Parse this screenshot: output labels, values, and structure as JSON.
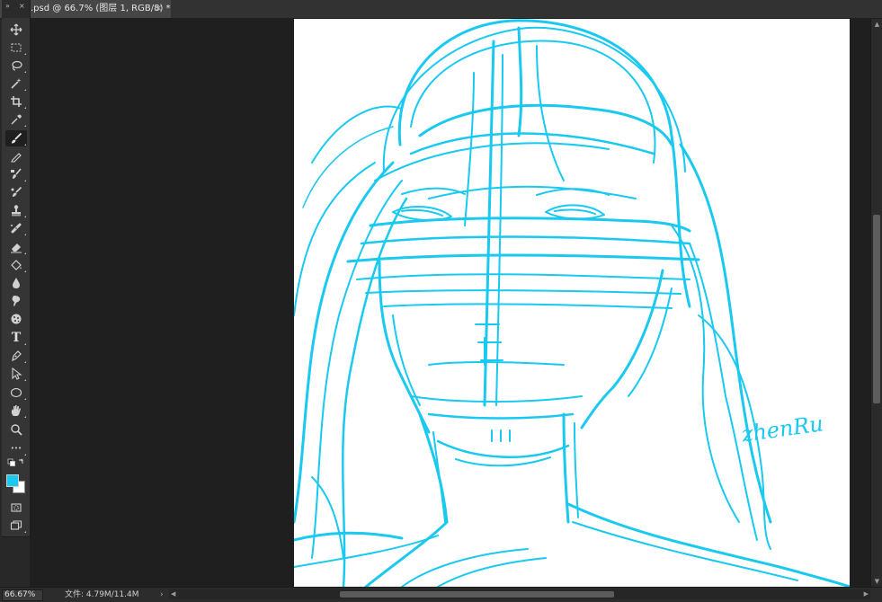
{
  "document_tab": {
    "title": ".psd @ 66.7% (图层 1, RGB/8) *",
    "close_glyph": "×"
  },
  "toolbar": {
    "collapse_glyph": "»",
    "close_glyph": "×",
    "tools": [
      {
        "name": "move-tool-icon"
      },
      {
        "name": "marquee-tool-icon"
      },
      {
        "name": "lasso-tool-icon"
      },
      {
        "name": "magic-wand-tool-icon"
      },
      {
        "name": "crop-tool-icon"
      },
      {
        "name": "eyedropper-tool-icon"
      },
      {
        "name": "brush-tool-icon",
        "active": true
      },
      {
        "name": "pencil-tool-icon"
      },
      {
        "name": "mixer-brush-tool-icon"
      },
      {
        "name": "history-brush-tool-icon"
      },
      {
        "name": "clone-stamp-tool-icon"
      },
      {
        "name": "healing-brush-tool-icon"
      },
      {
        "name": "eraser-tool-icon"
      },
      {
        "name": "paint-bucket-tool-icon"
      },
      {
        "name": "blur-tool-icon"
      },
      {
        "name": "smudge-tool-icon"
      },
      {
        "name": "sponge-tool-icon"
      },
      {
        "name": "type-tool-icon"
      },
      {
        "name": "pen-tool-icon"
      },
      {
        "name": "path-selection-tool-icon"
      },
      {
        "name": "ellipse-tool-icon"
      },
      {
        "name": "hand-tool-icon"
      },
      {
        "name": "zoom-tool-icon"
      },
      {
        "name": "more-tools-icon"
      }
    ],
    "type_tool_glyph": "T",
    "more_glyph": "•••",
    "foreground_color": "#19c9f0",
    "background_color": "#ffffff"
  },
  "canvas": {
    "stroke_color": "#19c9f0",
    "signature": "zhenRu"
  },
  "status_bar": {
    "zoom": "66.67%",
    "doc_info": "文件: 4.79M/11.4M",
    "arrow": "›"
  },
  "scrollbars": {
    "up": "▲",
    "down": "▼",
    "left": "◀",
    "right": "▶"
  }
}
